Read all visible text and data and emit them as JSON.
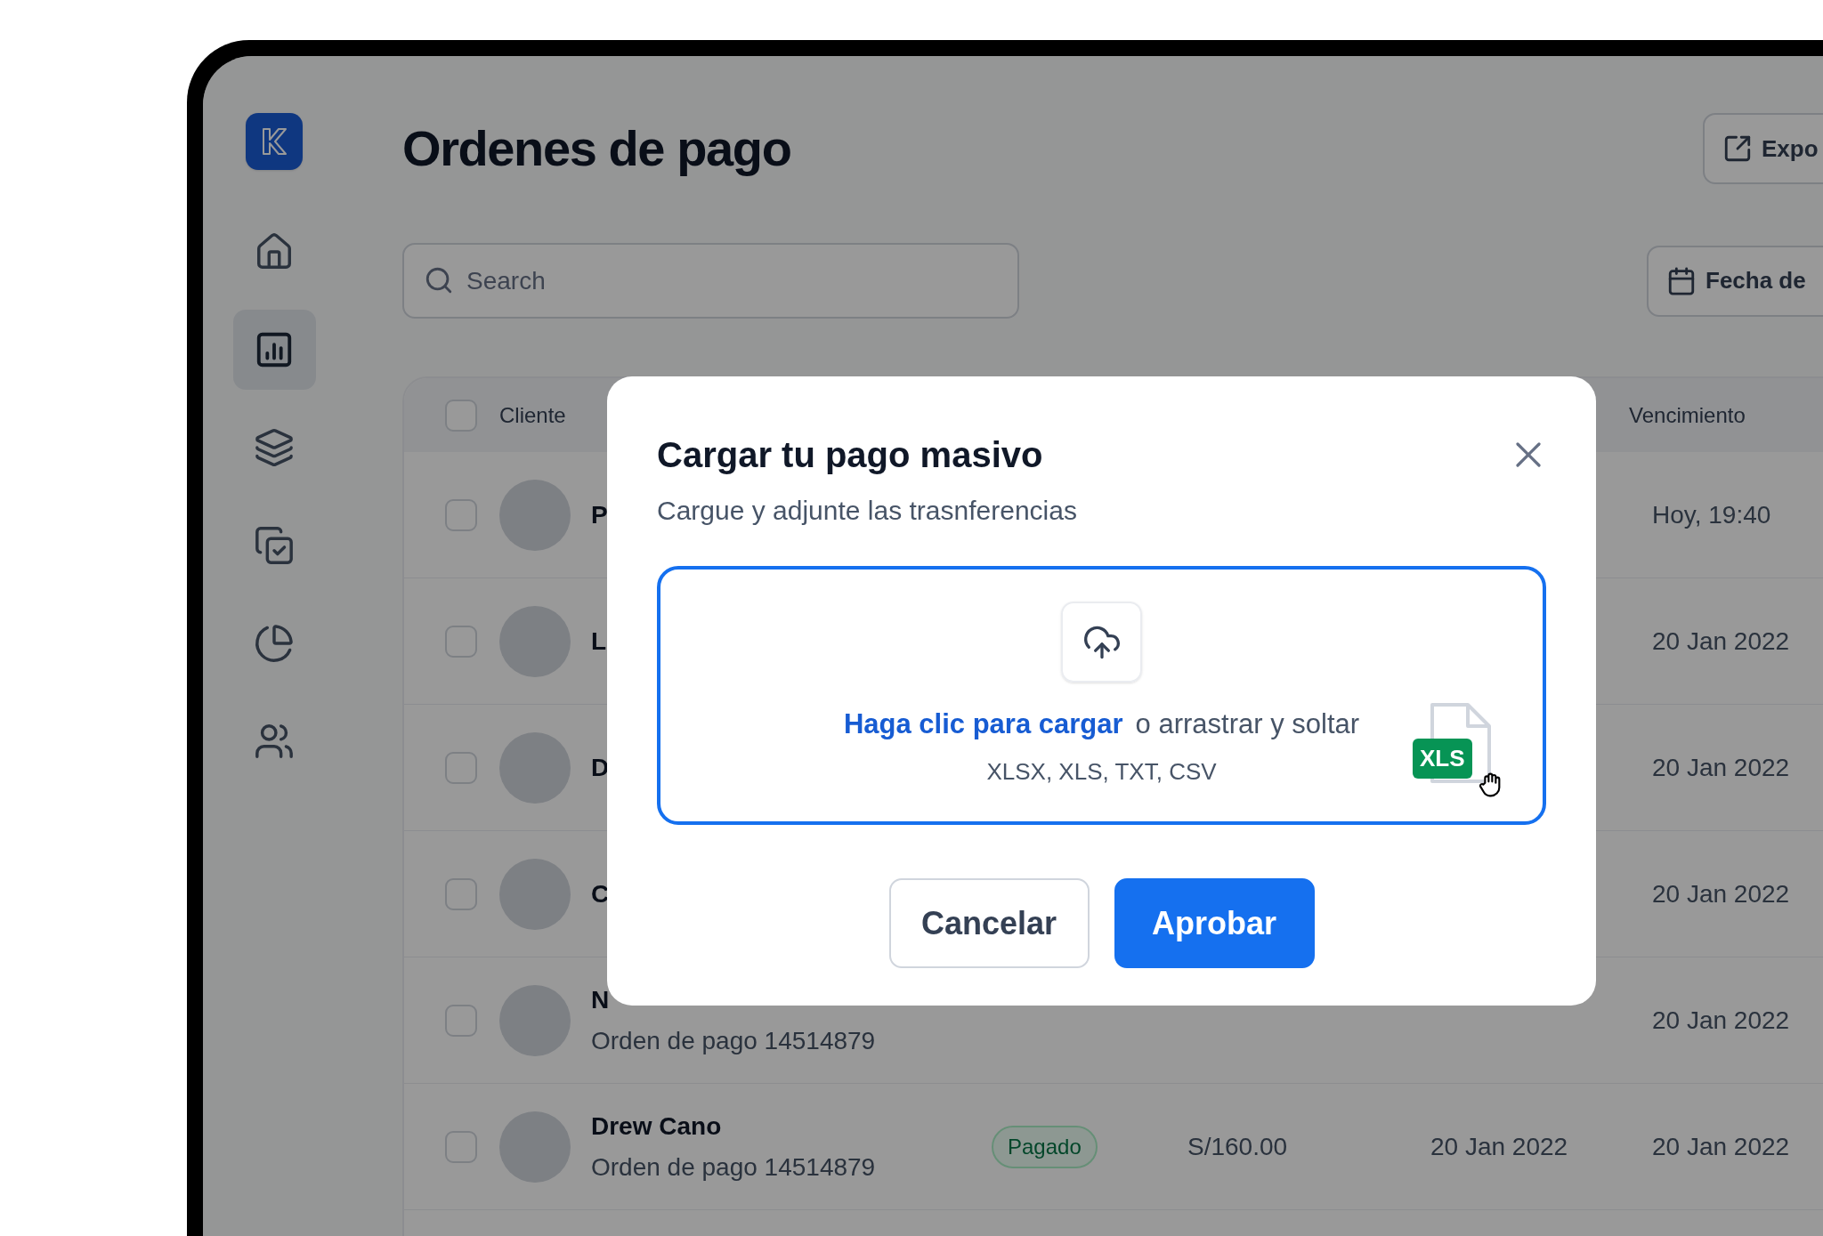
{
  "sidebar": {
    "items": [
      {
        "kind": "home",
        "selected": false
      },
      {
        "kind": "chart",
        "selected": true
      },
      {
        "kind": "layers",
        "selected": false
      },
      {
        "kind": "tasks",
        "selected": false
      },
      {
        "kind": "pie",
        "selected": false
      },
      {
        "kind": "users",
        "selected": false
      }
    ]
  },
  "header": {
    "title": "Ordenes de pago",
    "export_button": "Expo"
  },
  "search": {
    "placeholder": "Search"
  },
  "date_filter": {
    "label": "Fecha de"
  },
  "table": {
    "header": {
      "checked": false,
      "client": "Cliente",
      "due": "Vencimiento"
    },
    "rows": [
      {
        "checked": false,
        "name": "P",
        "due": "Hoy, 19:40"
      },
      {
        "checked": false,
        "name": "L",
        "due": "20 Jan 2022"
      },
      {
        "checked": false,
        "name": "D",
        "due": "20 Jan 2022"
      },
      {
        "checked": false,
        "name": "C",
        "due": "20 Jan 2022"
      },
      {
        "checked": false,
        "name": "N",
        "order": "Orden de pago 14514879",
        "due": "20 Jan 2022"
      },
      {
        "checked": false,
        "name": "Drew Cano",
        "order": "Orden de pago 14514879",
        "status": "Pagado",
        "amount": "S/160.00",
        "date": "20 Jan 2022",
        "due": "20 Jan 2022"
      }
    ]
  },
  "modal": {
    "title": "Cargar tu pago masivo",
    "subtitle": "Cargue y adjunte las trasnferencias",
    "dropzone": {
      "link": "Haga clic para cargar",
      "text": "o arrastrar y soltar",
      "formats": "XLSX, XLS, TXT, CSV",
      "file_badge": "XLS"
    },
    "buttons": [
      {
        "kind": "secondary",
        "label": "Cancelar"
      },
      {
        "kind": "primary",
        "label": "Aprobar"
      }
    ]
  }
}
